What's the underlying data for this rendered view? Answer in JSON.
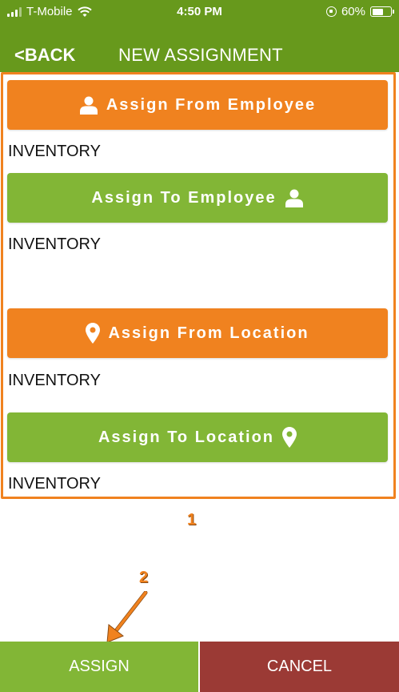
{
  "status_bar": {
    "carrier": "T-Mobile",
    "time": "4:50 PM",
    "battery": "60%",
    "battery_level": 0.6
  },
  "nav": {
    "back_label": "<BACK",
    "title": "NEW ASSIGNMENT"
  },
  "sections": [
    {
      "button_label": "Assign From Employee",
      "icon": "person-icon",
      "color": "#f0821f",
      "value": "INVENTORY"
    },
    {
      "button_label": "Assign To Employee",
      "icon": "person-icon",
      "color": "#82b636",
      "value": "INVENTORY"
    },
    {
      "button_label": "Assign From Location",
      "icon": "location-pin-icon",
      "color": "#f0821f",
      "value": "INVENTORY"
    },
    {
      "button_label": "Assign To Location",
      "icon": "location-pin-icon",
      "color": "#82b636",
      "value": "INVENTORY"
    }
  ],
  "annotations": {
    "marker_1": "1",
    "marker_2": "2"
  },
  "footer": {
    "assign_label": "ASSIGN",
    "cancel_label": "CANCEL"
  },
  "colors": {
    "header": "#67991c",
    "orange": "#f0821f",
    "green": "#82b636",
    "cancel": "#9b3a35"
  }
}
